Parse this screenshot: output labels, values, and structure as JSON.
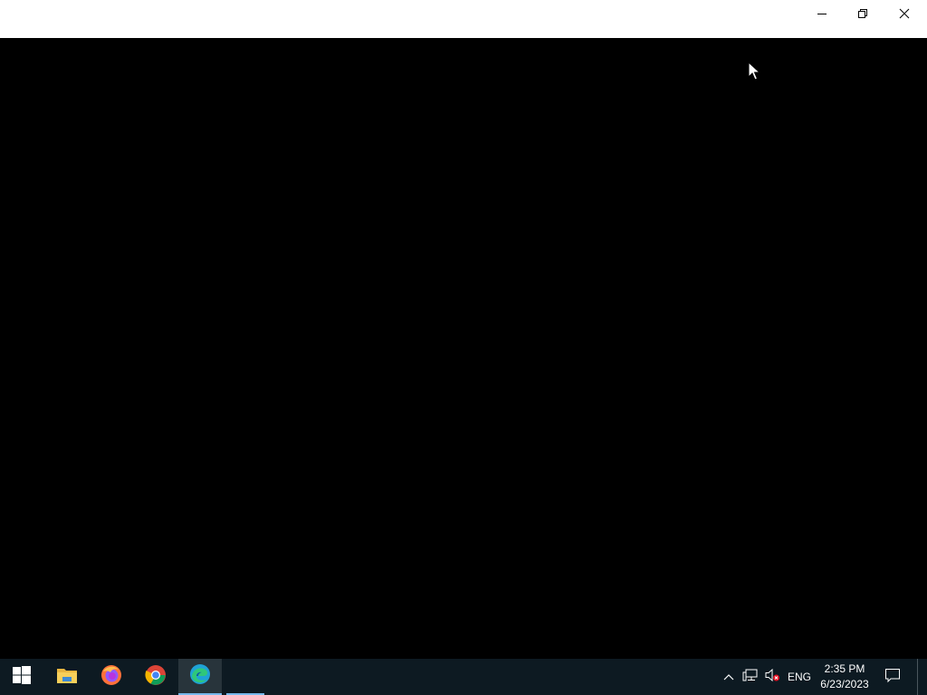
{
  "window": {
    "controls": {
      "minimize": "minimize-icon",
      "restore": "restore-icon",
      "close": "close-icon"
    }
  },
  "taskbar": {
    "start_icon": "windows-logo-icon",
    "apps": [
      {
        "name": "File Explorer",
        "icon": "folder-icon"
      },
      {
        "name": "Firefox",
        "icon": "firefox-icon"
      },
      {
        "name": "Google Chrome",
        "icon": "chrome-icon"
      },
      {
        "name": "Microsoft Edge",
        "icon": "edge-icon",
        "active": true
      }
    ],
    "tray": {
      "language": "ENG",
      "time": "2:35 PM",
      "date": "6/23/2023"
    }
  },
  "colors": {
    "taskbar_bg": "#0d1a22",
    "active_indicator": "#76b9ed",
    "window_content": "#000000",
    "titlebar": "#ffffff"
  }
}
